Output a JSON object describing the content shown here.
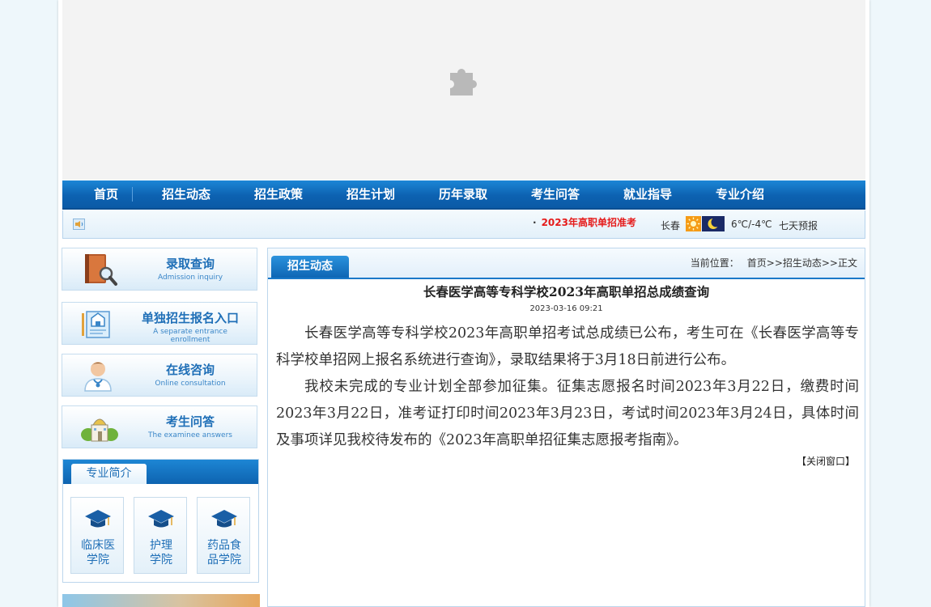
{
  "nav": {
    "items": [
      "首页",
      "招生动态",
      "招生政策",
      "招生计划",
      "历年录取",
      "考生问答",
      "就业指导",
      "专业介绍"
    ]
  },
  "infobar": {
    "marquee_text": "2023年高职单招准考",
    "weather": {
      "city": "长春",
      "temperature": "6℃/-4℃",
      "forecast_link": "七天预报"
    }
  },
  "sidebar": {
    "buttons": [
      {
        "title": "录取查询",
        "subtitle": "Admission inquiry",
        "icon": "book-magnifier-icon"
      },
      {
        "title": "单独招生报名入口",
        "subtitle": "A separate entrance enrollment",
        "icon": "enrollment-document-icon"
      },
      {
        "title": "在线咨询",
        "subtitle": "Online consultation",
        "icon": "doctor-icon"
      },
      {
        "title": "考生问答",
        "subtitle": "The examinee answers",
        "icon": "campus-building-icon"
      }
    ],
    "majors": {
      "heading": "专业简介",
      "items": [
        {
          "line1": "临床医",
          "line2": "学院"
        },
        {
          "line1": "护理",
          "line2": "学院"
        },
        {
          "line1": "药品食",
          "line2": "品学院"
        }
      ]
    }
  },
  "main": {
    "tab": "招生动态",
    "breadcrumb": {
      "label": "当前位置：",
      "path": "首页>>招生动态>>正文"
    },
    "article": {
      "title": "长春医学高等专科学校2023年高职单招总成绩查询",
      "date": "2023-03-16 09:21",
      "paragraphs": [
        "长春医学高等专科学校2023年高职单招考试总成绩已公布，考生可在《长春医学高等专科学校单招网上报名系统进行查询》，录取结果将于3月18日前进行公布。",
        "我校未完成的专业计划全部参加征集。征集志愿报名时间2023年3月22日，缴费时间2023年3月22日，准考证打印时间2023年3月23日，考试时间2023年3月24日，具体时间及事项详见我校待发布的《2023年高职单招征集志愿报考指南》。"
      ],
      "close_link": "【关闭窗口】"
    }
  },
  "colors": {
    "nav_blue": "#0d62b1",
    "accent_red": "#e51b1b",
    "link_blue": "#1f6fb7"
  }
}
